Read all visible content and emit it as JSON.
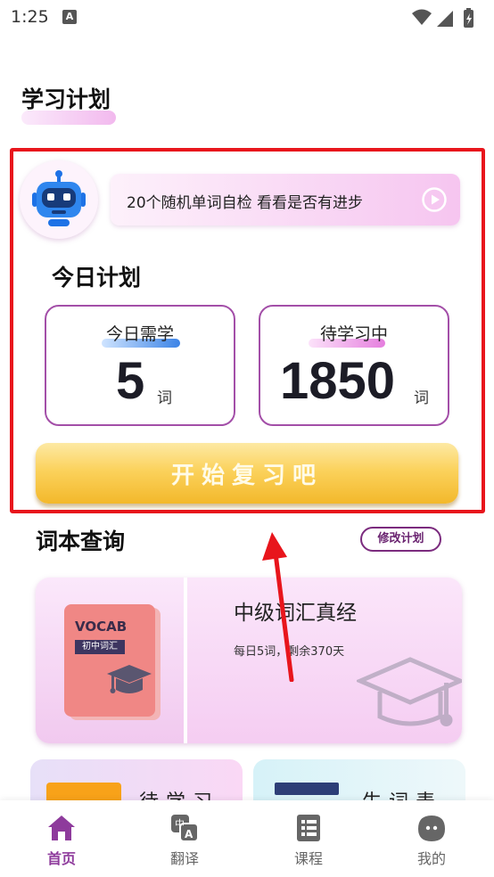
{
  "status_bar": {
    "time": "1:25",
    "notification_letter": "A"
  },
  "study_plan": {
    "title": "学习计划"
  },
  "banner": {
    "text": "20个随机单词自检  看看是否有进步"
  },
  "today_plan": {
    "title": "今日计划",
    "need_label": "今日需学",
    "need_value": "5",
    "need_unit": "词",
    "pending_label": "待学习中",
    "pending_value": "1850",
    "pending_unit": "词",
    "start_button": "开始复习吧"
  },
  "vocab_query": {
    "title": "词本查询",
    "edit_button": "修改计划",
    "book": {
      "cover_title": "VOCAB",
      "cover_tag": "初中词汇",
      "name": "中级词汇真经",
      "progress": "每日5词，剩余370天"
    },
    "mini_cards": [
      {
        "label": "待学习"
      },
      {
        "label": "生词表"
      }
    ]
  },
  "bottom_nav": {
    "items": [
      {
        "label": "首页",
        "icon": "home-icon"
      },
      {
        "label": "翻译",
        "icon": "translate-icon"
      },
      {
        "label": "课程",
        "icon": "course-icon"
      },
      {
        "label": "我的",
        "icon": "profile-icon"
      }
    ]
  },
  "colors": {
    "accent_purple": "#8e3b9c",
    "highlight_red": "#e8151c",
    "button_gold": "#fbd25c",
    "card_border": "#a34fa8"
  }
}
